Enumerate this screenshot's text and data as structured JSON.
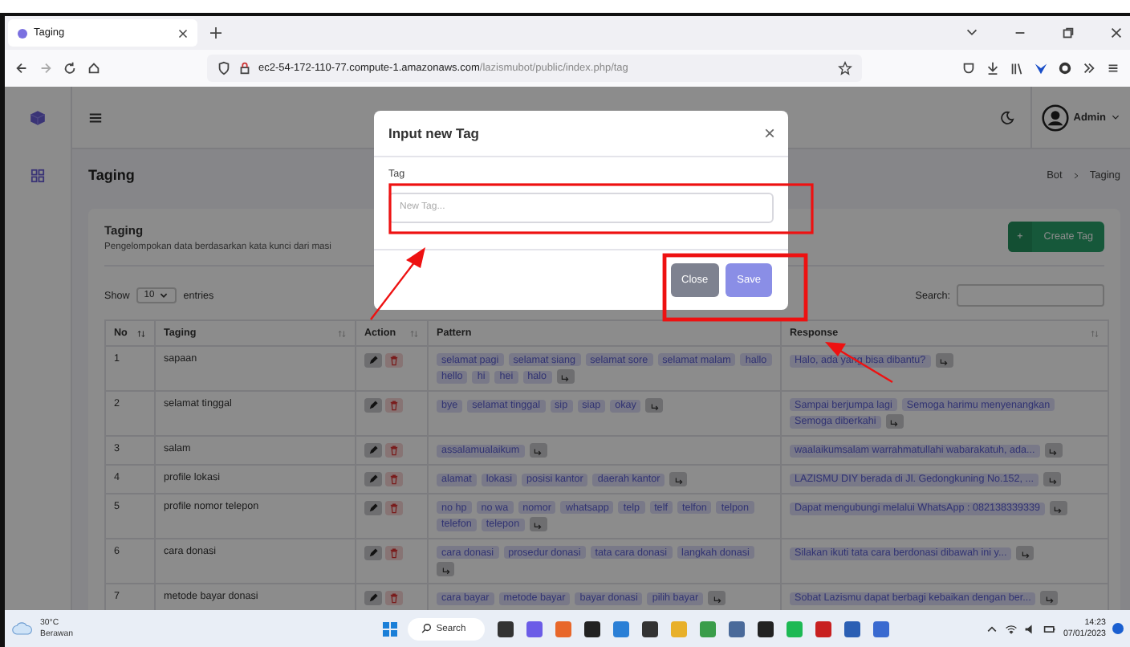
{
  "browser": {
    "tab_title": "Taging",
    "url_host": "ec2-54-172-110-77.compute-1.amazonaws.com",
    "url_path": "/lazismubot/public/index.php/tag"
  },
  "header": {
    "user": "Admin"
  },
  "page": {
    "title": "Taging",
    "breadcrumb": [
      "Bot",
      "Taging"
    ]
  },
  "card": {
    "title": "Taging",
    "subtitle": "Pengelompokan data berdasarkan kata kunci dari masi",
    "create_button": "Create Tag",
    "create_icon": "+",
    "show_label": "Show",
    "page_size": "10",
    "entries_label": "entries",
    "search_label": "Search:"
  },
  "table": {
    "columns": [
      "No",
      "Taging",
      "Action",
      "Pattern",
      "Response"
    ],
    "rows": [
      {
        "no": "1",
        "taging": "sapaan",
        "patterns": [
          "selamat pagi",
          "selamat siang",
          "selamat sore",
          "selamat malam",
          "hallo",
          "hello",
          "hi",
          "hei",
          "halo"
        ],
        "responses": [
          "Halo, ada yang bisa dibantu?"
        ]
      },
      {
        "no": "2",
        "taging": "selamat tinggal",
        "patterns": [
          "bye",
          "selamat tinggal",
          "sip",
          "siap",
          "okay"
        ],
        "responses": [
          "Sampai berjumpa lagi",
          "Semoga harimu menyenangkan",
          "Semoga diberkahi"
        ]
      },
      {
        "no": "3",
        "taging": "salam",
        "patterns": [
          "assalamualaikum"
        ],
        "responses": [
          "waalaikumsalam warrahmatullahi wabarakatuh, ada..."
        ]
      },
      {
        "no": "4",
        "taging": "profile lokasi",
        "patterns": [
          "alamat",
          "lokasi",
          "posisi kantor",
          "daerah kantor"
        ],
        "responses": [
          "LAZISMU DIY berada di Jl. Gedongkuning No.152, ..."
        ]
      },
      {
        "no": "5",
        "taging": "profile nomor telepon",
        "patterns": [
          "no hp",
          "no wa",
          "nomor",
          "whatsapp",
          "telp",
          "telf",
          "telfon",
          "telpon",
          "telefon",
          "telepon"
        ],
        "responses": [
          "Dapat mengubungi melalui WhatsApp : 082138339339"
        ]
      },
      {
        "no": "6",
        "taging": "cara donasi",
        "patterns": [
          "cara donasi",
          "prosedur donasi",
          "tata cara donasi",
          "langkah donasi"
        ],
        "responses": [
          "Silakan ikuti tata cara berdonasi dibawah ini y..."
        ]
      },
      {
        "no": "7",
        "taging": "metode bayar donasi",
        "patterns": [
          "cara bayar",
          "metode bayar",
          "bayar donasi",
          "pilih bayar"
        ],
        "responses": [
          "Sobat Lazismu dapat berbagi kebaikan dengan ber..."
        ]
      }
    ]
  },
  "modal": {
    "title": "Input new Tag",
    "close_glyph": "×",
    "field_label": "Tag",
    "placeholder": "New Tag...",
    "buttons": [
      "Close",
      "Save"
    ]
  },
  "taskbar": {
    "temperature": "30°C",
    "weather": "Berawan",
    "search": "Search",
    "time": "14:23",
    "date": "07/01/2023"
  }
}
